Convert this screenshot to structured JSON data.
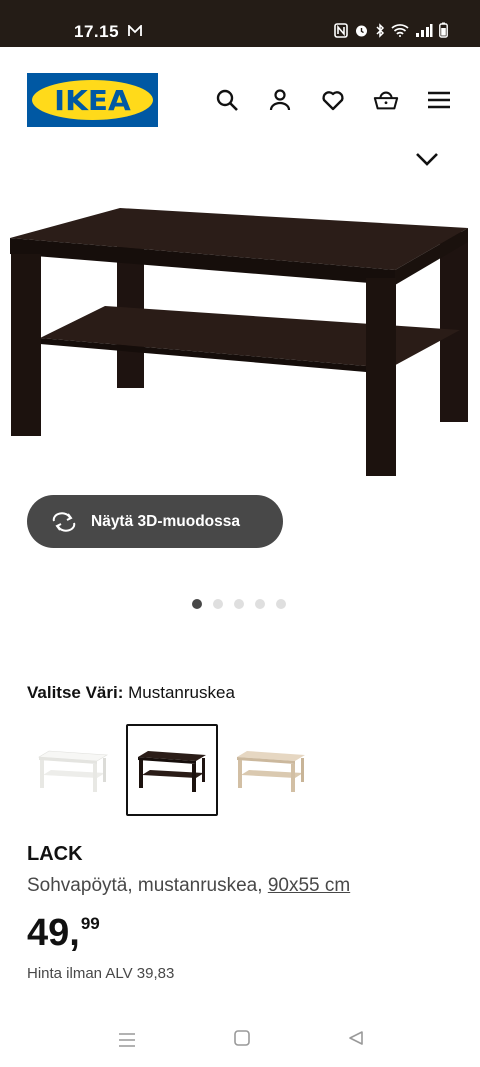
{
  "status_bar": {
    "time": "17.15",
    "background": "#241c16"
  },
  "header": {
    "logo_text": "IKEA",
    "logo_colors": {
      "blue": "#0058a3",
      "yellow": "#ffda1a"
    },
    "icons": [
      "search-icon",
      "account-icon",
      "heart-icon",
      "basket-icon",
      "menu-icon"
    ]
  },
  "view_3d": {
    "label": "Näytä 3D-muodossa",
    "icon": "rotate-icon",
    "color": "#484848"
  },
  "carousel": {
    "total": 5,
    "active_index": 0
  },
  "color_picker": {
    "label": "Valitse Väri:",
    "selected_value": "Mustanruskea",
    "options": [
      {
        "name": "white",
        "color": "#f4f4f2",
        "selected": false
      },
      {
        "name": "black-brown",
        "color": "#2b1d18",
        "selected": true
      },
      {
        "name": "white-stained-oak",
        "color": "#dccbb2",
        "selected": false
      }
    ]
  },
  "product": {
    "name": "LACK",
    "description": "Sohvapöytä, mustanruskea,",
    "dimensions": "90x55 cm",
    "price_int": "49,",
    "price_dec": "99",
    "vat_text": "Hinta ilman ALV 39,83"
  }
}
